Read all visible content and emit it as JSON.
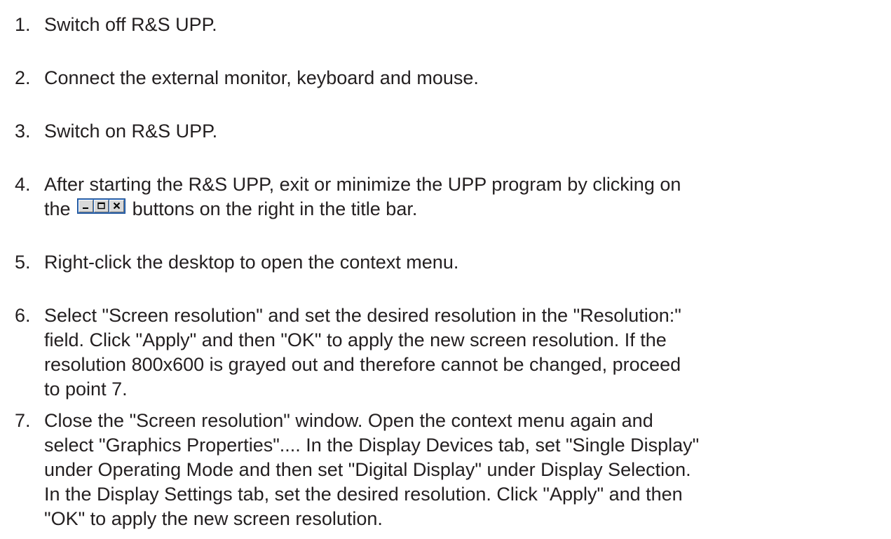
{
  "steps": [
    {
      "num": "1.",
      "lines": [
        "Switch off R&S UPP."
      ]
    },
    {
      "num": "2.",
      "lines": [
        "Connect the external monitor, keyboard and mouse."
      ]
    },
    {
      "num": "3.",
      "lines": [
        "Switch on R&S UPP."
      ]
    },
    {
      "num": "4.",
      "line1": "After starting the R&S UPP, exit or minimize the UPP program by clicking on",
      "line2_before": "the",
      "line2_after": "buttons on the right in the title bar."
    },
    {
      "num": "5.",
      "lines": [
        "Right-click the desktop to open the context menu."
      ]
    },
    {
      "num": "6.",
      "lines": [
        "Select \"Screen resolution\" and set the desired resolution in the \"Resolution:\"",
        "field. Click \"Apply\" and then \"OK\" to apply the new screen resolution. If the",
        "resolution 800x600 is grayed out and therefore cannot be changed, proceed",
        "to point 7."
      ]
    },
    {
      "num": "7.",
      "lines": [
        "Close the \"Screen resolution\" window. Open the context menu again and",
        "select \"Graphics Properties\".... In the Display Devices tab, set \"Single Display\"",
        "under Operating Mode and then set \"Digital Display\" under Display Selection.",
        "In the Display Settings tab, set the desired resolution. Click \"Apply\" and then",
        "\"OK\" to apply the new screen resolution."
      ]
    }
  ],
  "window_controls_icons": [
    "minimize-icon",
    "maximize-icon",
    "close-icon"
  ]
}
